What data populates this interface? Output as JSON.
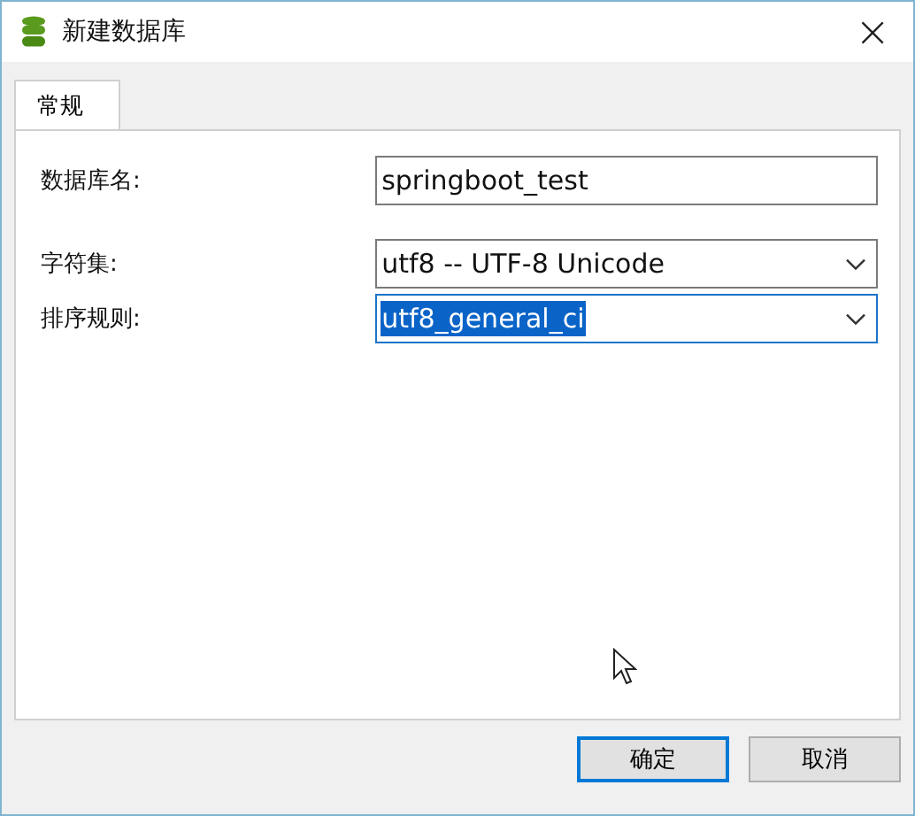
{
  "window": {
    "title": "新建数据库",
    "close": "×"
  },
  "tabs": [
    {
      "label": "常规",
      "selected": true
    }
  ],
  "fields": [
    {
      "kind": "text",
      "label": "数据库名:",
      "value": "springboot_test",
      "focused": false
    },
    {
      "kind": "select",
      "label": "字符集:",
      "value": "utf8 -- UTF-8 Unicode",
      "focused": false
    },
    {
      "kind": "select",
      "label": "排序规则:",
      "value": "utf8_general_ci",
      "focused": true
    }
  ],
  "buttons": [
    {
      "label": "确定",
      "default": true
    },
    {
      "label": "取消",
      "default": false
    }
  ]
}
